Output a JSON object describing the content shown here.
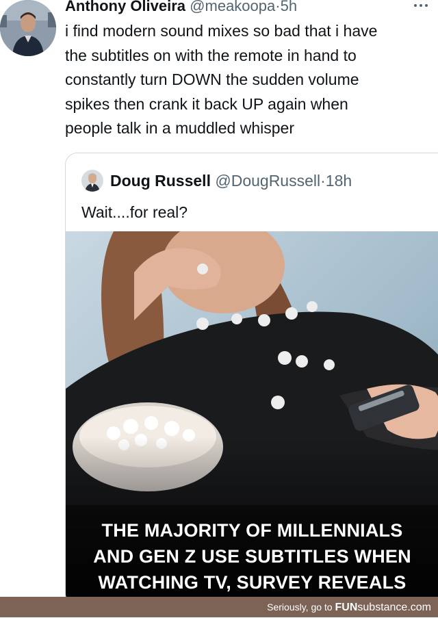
{
  "tweet": {
    "author_name": "Anthony Oliveira",
    "handle": "@meakoopa",
    "separator": "·",
    "time": "5h",
    "text_lines": [
      "i find modern sound mixes so bad that i have",
      "the subtitles on with the remote in hand to",
      "constantly turn DOWN the sudden volume",
      "spikes then crank it back UP again when",
      "people talk in a muddled whisper"
    ],
    "more_icon": "more-horizontal-icon"
  },
  "quote": {
    "author_name": "Doug Russell",
    "handle": "@DougRussell",
    "separator": "·",
    "time": "18h",
    "text": "Wait....for real?",
    "media": {
      "headline_lines": [
        "THE MAJORITY OF MILLENNIALS",
        "AND GEN Z USE SUBTITLES WHEN",
        "WATCHING TV, SURVEY REVEALS"
      ]
    }
  },
  "footer": {
    "prefix": "Seriously, go to",
    "brand_fun": "FUN",
    "brand_substance": "substance",
    "brand_suffix": ".com"
  },
  "colors": {
    "text_primary": "#0f1419",
    "text_secondary": "#536471",
    "card_border": "#cfd9de",
    "footer_bg": "#7c6355"
  }
}
